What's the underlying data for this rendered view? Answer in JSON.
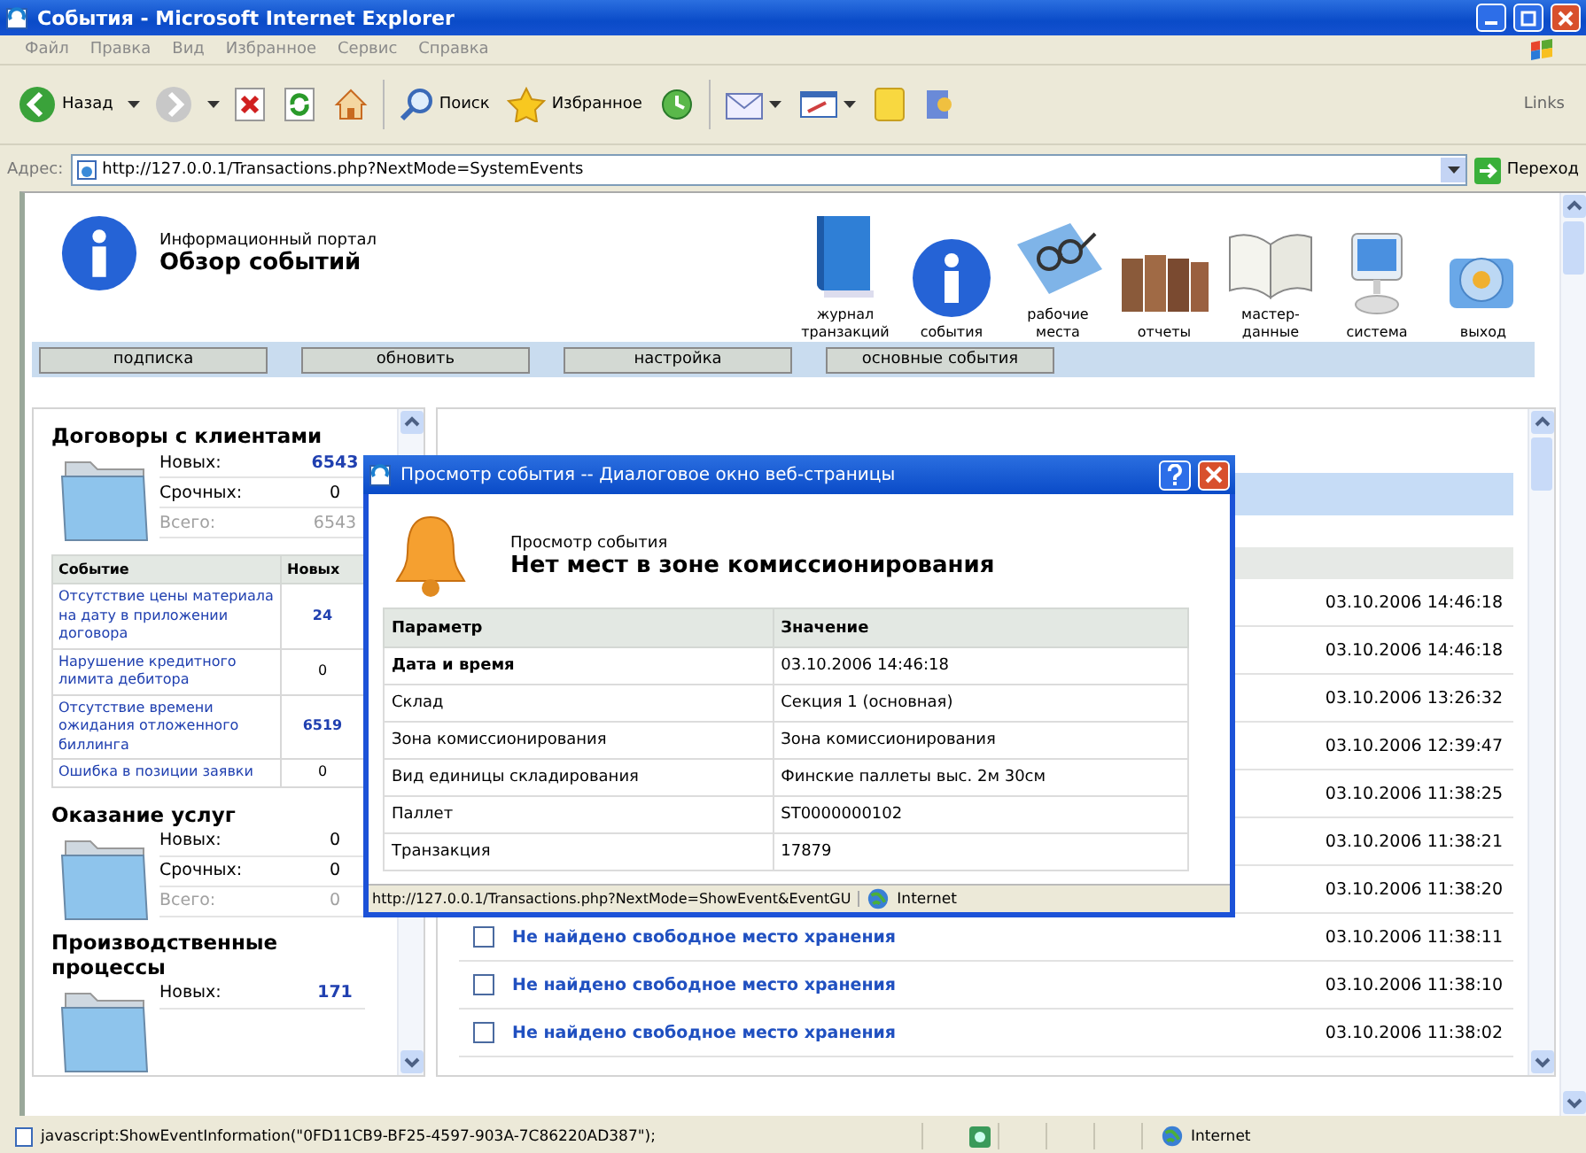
{
  "window": {
    "title": "События - Microsoft Internet Explorer"
  },
  "menu": [
    "Файл",
    "Правка",
    "Вид",
    "Избранное",
    "Сервис",
    "Справка"
  ],
  "toolbar": {
    "back": "Назад",
    "search": "Поиск",
    "favorites": "Избранное",
    "links": "Links"
  },
  "address": {
    "label": "Адрес:",
    "value": "http://127.0.0.1/Transactions.php?NextMode=SystemEvents",
    "go": "Переход"
  },
  "portal": {
    "subtitle": "Информационный портал",
    "title": "Обзор событий"
  },
  "nav": [
    {
      "kind": "journal",
      "label": "журнал транзакций"
    },
    {
      "kind": "events",
      "label": "события"
    },
    {
      "kind": "workplaces",
      "label": "рабочие места"
    },
    {
      "kind": "reports",
      "label": "отчеты"
    },
    {
      "kind": "masterdata",
      "label": "мастер-данные"
    },
    {
      "kind": "system",
      "label": "система"
    },
    {
      "kind": "exit",
      "label": "выход"
    }
  ],
  "actions": [
    "подписка",
    "обновить",
    "настройка",
    "основные события"
  ],
  "groups": [
    {
      "title": "Договоры с клиентами",
      "counts": [
        {
          "kind": "new",
          "label": "Новых:",
          "value": "6543",
          "highlighted": true
        },
        {
          "kind": "urgent",
          "label": "Срочных:",
          "value": "0",
          "highlighted": false
        },
        {
          "kind": "total",
          "label": "Всего:",
          "value": "6543",
          "highlighted": false
        }
      ],
      "table": {
        "columns": [
          "Событие",
          "Новых"
        ],
        "rows": [
          {
            "event": "Отсутствие цены материала на дату в приложении договора",
            "count": "24",
            "highlighted": true
          },
          {
            "event": "Нарушение кредитного лимита дебитора",
            "count": "0",
            "highlighted": false
          },
          {
            "event": "Отсутствие времени ожидания отложенного биллинга",
            "count": "6519",
            "highlighted": true
          },
          {
            "event": "Ошибка в позиции заявки",
            "count": "0",
            "highlighted": false
          }
        ]
      }
    },
    {
      "title": "Оказание услуг",
      "counts": [
        {
          "kind": "new",
          "label": "Новых:",
          "value": "0",
          "highlighted": false
        },
        {
          "kind": "urgent",
          "label": "Срочных:",
          "value": "0",
          "highlighted": false
        },
        {
          "kind": "total",
          "label": "Всего:",
          "value": "0",
          "highlighted": false
        }
      ]
    },
    {
      "title": "Производственные процессы",
      "counts": [
        {
          "kind": "new",
          "label": "Новых:",
          "value": "171",
          "highlighted": true
        }
      ]
    }
  ],
  "events": [
    {
      "time": "03.10.2006 14:46:18"
    },
    {
      "time": "03.10.2006 14:46:18"
    },
    {
      "time": "03.10.2006 13:26:32"
    },
    {
      "time": "03.10.2006 12:39:47"
    },
    {
      "time": "03.10.2006 11:38:25"
    },
    {
      "time": "03.10.2006 11:38:21"
    },
    {
      "time": "03.10.2006 11:38:20"
    },
    {
      "title": "Не найдено свободное место хранения",
      "checked": false,
      "time": "03.10.2006 11:38:11"
    },
    {
      "title": "Не найдено свободное место хранения",
      "checked": false,
      "time": "03.10.2006 11:38:10"
    },
    {
      "title": "Не найдено свободное место хранения",
      "checked": false,
      "time": "03.10.2006 11:38:02"
    }
  ],
  "dialog": {
    "title": "Просмотр события -- Диалоговое окно веб-страницы",
    "caption": "Просмотр события",
    "heading": "Нет мест в зоне комиссионирования",
    "columns": [
      "Параметр",
      "Значение"
    ],
    "rows": [
      {
        "param": "Дата и время",
        "value": "03.10.2006 14:46:18",
        "bold": true
      },
      {
        "param": "Склад",
        "value": "Секция 1 (основная)",
        "bold": false
      },
      {
        "param": "Зона комиссионирования",
        "value": "Зона комиссионирования",
        "bold": false
      },
      {
        "param": "Вид единицы складирования",
        "value": "Финские паллеты выс. 2м 30см",
        "bold": false
      },
      {
        "param": "Паллет",
        "value": "ST0000000102",
        "bold": false
      },
      {
        "param": "Транзакция",
        "value": "17879",
        "bold": false
      }
    ],
    "status_url": "http://127.0.0.1/Transactions.php?NextMode=ShowEvent&EventGU",
    "zone": "Internet"
  },
  "status_bar": {
    "text": "javascript:ShowEventInformation(\"0FD11CB9-BF25-4597-903A-7C86220AD387\");",
    "zone": "Internet"
  }
}
